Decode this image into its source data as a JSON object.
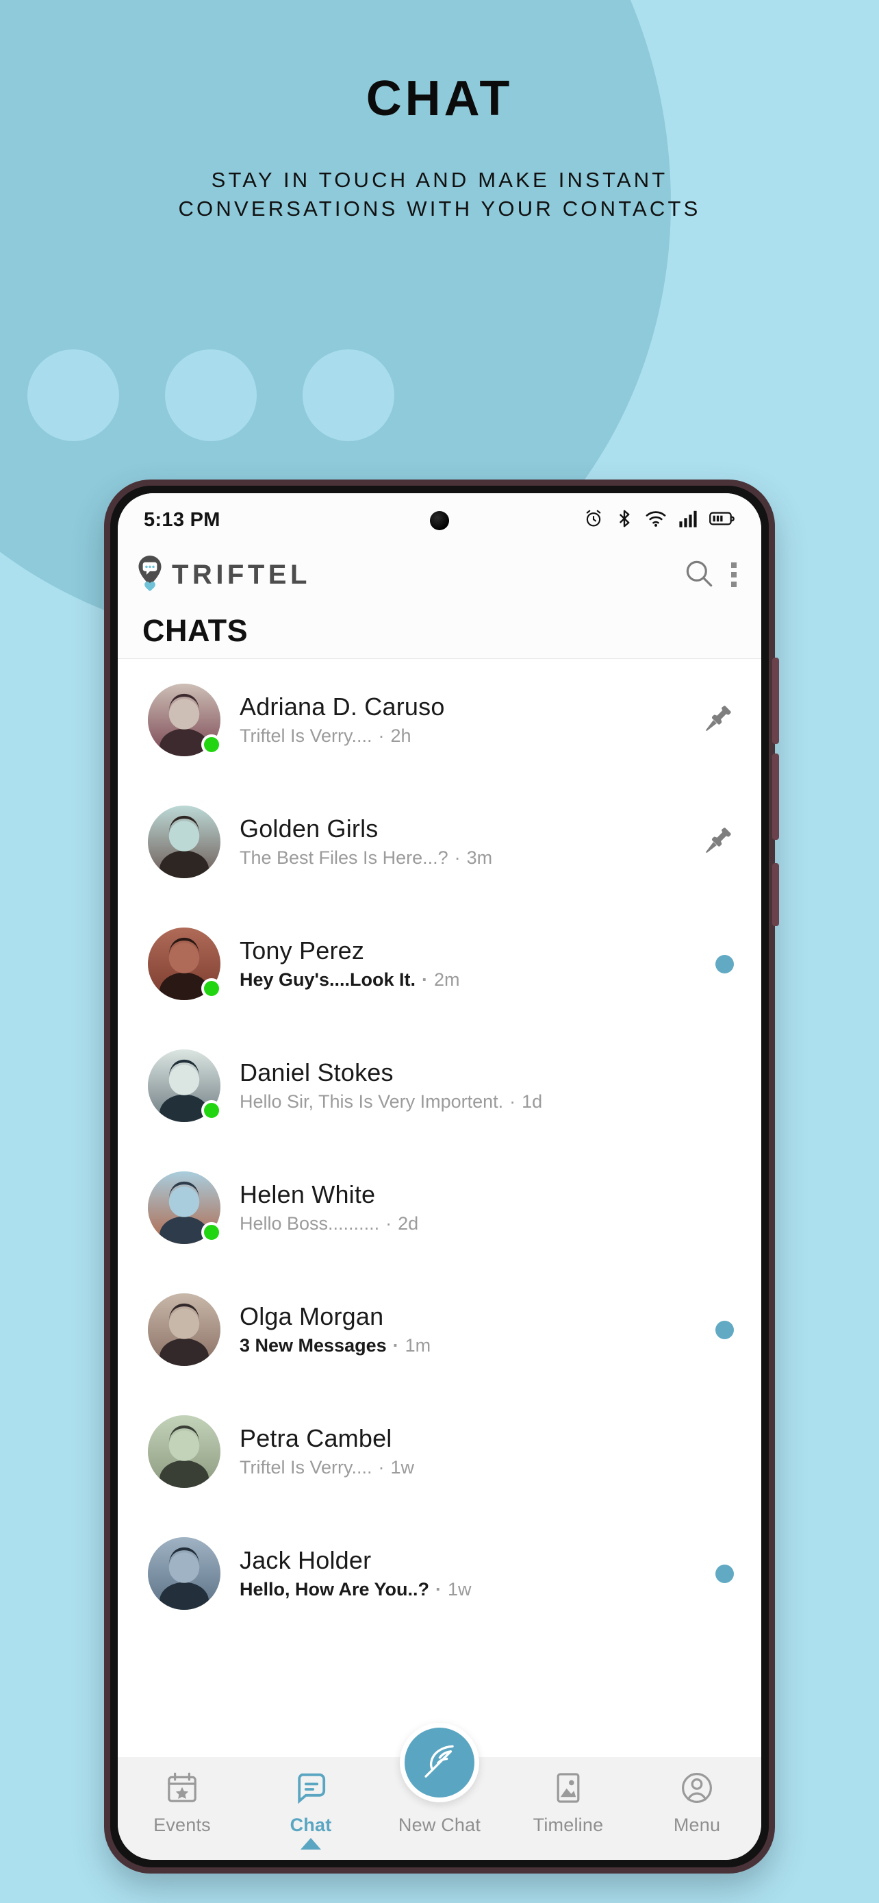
{
  "marketing": {
    "title": "CHAT",
    "subtitle_line1": "STAY IN TOUCH AND MAKE INSTANT",
    "subtitle_line2": "CONVERSATIONS WITH YOUR CONTACTS"
  },
  "colors": {
    "page_background": "#ade0ef",
    "blob": "#8ecada",
    "decor_circle": "#a9dced",
    "accent": "#5aa6c2",
    "unread_dot": "#62aac4",
    "online_dot": "#22d511",
    "brand_text": "#4d4d4d",
    "device_frame": "#4a3239"
  },
  "status_bar": {
    "time": "5:13 PM",
    "icons": [
      "alarm-icon",
      "bluetooth-icon",
      "wifi-icon",
      "cellular-signal-icon",
      "battery-icon"
    ]
  },
  "app_bar": {
    "brand_name": "TRIFTEL",
    "logo_icon": "location-pin-chat-logo-icon",
    "search_icon": "search-icon",
    "overflow_icon": "overflow-menu-icon"
  },
  "section": {
    "title": "CHATS"
  },
  "pinned_chats": [
    {
      "name": "Adriana D. Caruso",
      "preview": "Triftel Is Verry....",
      "time": "2h",
      "unread": false,
      "online": true,
      "pinned": true,
      "trailing_icon": "pin-icon",
      "avatar": "woman-hugging-child-photo"
    },
    {
      "name": "Golden Girls",
      "preview": "The Best Files Is Here...?",
      "time": "3m",
      "unread": false,
      "online": false,
      "pinned": true,
      "trailing_icon": "pin-icon",
      "avatar": "group-of-women-photo"
    }
  ],
  "chats": [
    {
      "name": "Tony Perez",
      "preview": "Hey Guy's....Look It.",
      "time": "2m",
      "unread": true,
      "online": true,
      "pinned": false,
      "trailing_icon": "unread-dot",
      "avatar": "smiling-man-photo"
    },
    {
      "name": "Daniel Stokes",
      "preview": "Hello Sir, This Is Very Importent.",
      "time": "1d",
      "unread": false,
      "online": true,
      "pinned": false,
      "trailing_icon": "none",
      "avatar": "man-dark-shirt-photo"
    },
    {
      "name": "Helen White",
      "preview": "Hello Boss..........",
      "time": "2d",
      "unread": false,
      "online": true,
      "pinned": false,
      "trailing_icon": "none",
      "avatar": "red-haired-woman-photo"
    },
    {
      "name": "Olga Morgan",
      "preview": "3 New Messages",
      "time": "1m",
      "unread": true,
      "online": false,
      "pinned": false,
      "trailing_icon": "unread-dot",
      "avatar": "woman-headscarf-photo"
    },
    {
      "name": "Petra Cambel",
      "preview": "Triftel Is Verry....",
      "time": "1w",
      "unread": false,
      "online": false,
      "pinned": false,
      "trailing_icon": "none",
      "avatar": "woman-white-shirt-photo"
    },
    {
      "name": "Jack Holder",
      "preview": "Hello, How Are You..?",
      "time": "1w",
      "unread": true,
      "online": false,
      "pinned": false,
      "trailing_icon": "unread-dot",
      "avatar": "man-suit-photo"
    }
  ],
  "bottom_nav": {
    "items": [
      {
        "label": "Events",
        "icon": "calendar-star-icon",
        "active": false
      },
      {
        "label": "Chat",
        "icon": "chat-bubble-icon",
        "active": true
      },
      {
        "label": "New Chat",
        "icon": "feather-quill-icon",
        "active": false
      },
      {
        "label": "Timeline",
        "icon": "image-photo-icon",
        "active": false
      },
      {
        "label": "Menu",
        "icon": "person-account-icon",
        "active": false
      }
    ]
  }
}
